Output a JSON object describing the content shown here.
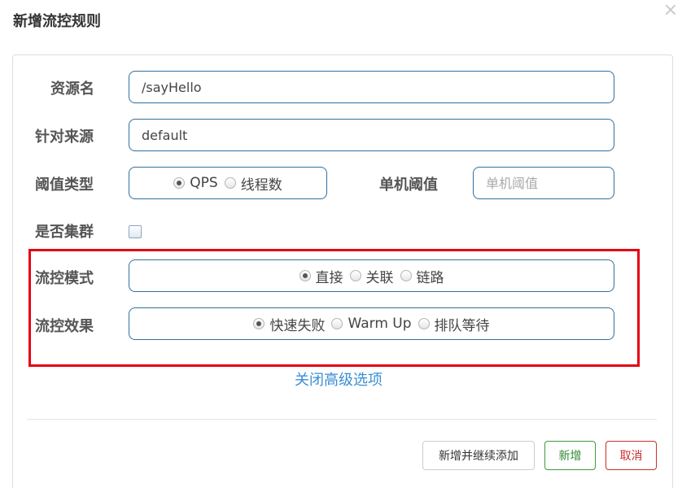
{
  "dialog": {
    "title": "新增流控规则",
    "close_icon": "close-icon"
  },
  "form": {
    "resource_name": {
      "label": "资源名",
      "value": "/sayHello"
    },
    "limit_app": {
      "label": "针对来源",
      "value": "default"
    },
    "threshold_type": {
      "label": "阈值类型",
      "options": [
        "QPS",
        "线程数"
      ],
      "selected": "QPS"
    },
    "single_threshold": {
      "label": "单机阈值",
      "value": "",
      "placeholder": "单机阈值"
    },
    "cluster_mode": {
      "label": "是否集群",
      "checked": false
    },
    "strategy": {
      "label": "流控模式",
      "options": [
        "直接",
        "关联",
        "链路"
      ],
      "selected": "直接"
    },
    "control_behavior": {
      "label": "流控效果",
      "options": [
        "快速失败",
        "Warm Up",
        "排队等待"
      ],
      "selected": "快速失败"
    },
    "advanced_link": "关闭高级选项"
  },
  "footer": {
    "continue_label": "新增并继续添加",
    "add_label": "新增",
    "cancel_label": "取消"
  },
  "colors": {
    "input_border": "#2f6f9f",
    "highlight": "#e60012",
    "link": "#3a8ed4",
    "add_button": "#3c9a3c",
    "cancel_button": "#c9302c"
  }
}
